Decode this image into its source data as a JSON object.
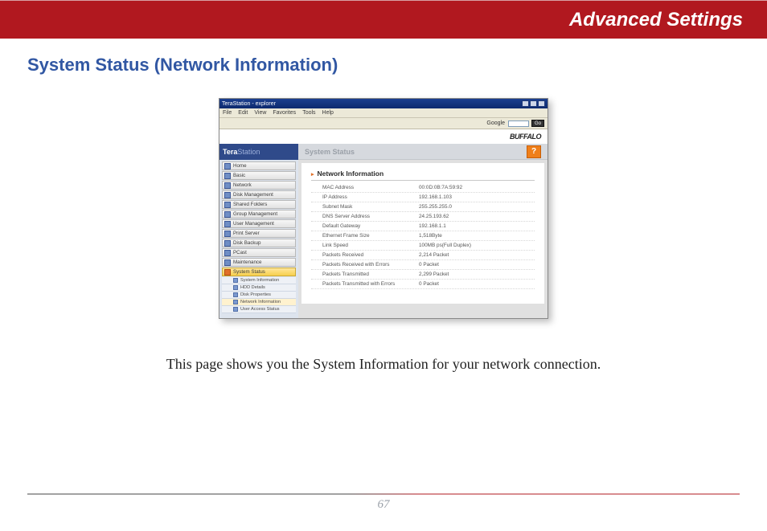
{
  "header": {
    "title": "Advanced Settings"
  },
  "section": {
    "title": "System Status (Network Information)"
  },
  "screenshot": {
    "window_title": "TeraStation - explorer",
    "menu": {
      "file": "File",
      "edit": "Edit",
      "view": "View",
      "favorites": "Favorites",
      "tools": "Tools",
      "help": "Help"
    },
    "search": {
      "label": "Google",
      "go": "Go"
    },
    "brand": "BUFFALO",
    "logo": {
      "tera": "Tera",
      "station": "Station"
    },
    "nav": {
      "items": [
        "Home",
        "Basic",
        "Network",
        "Disk Management",
        "Shared Folders",
        "Group Management",
        "User Management",
        "Print Server",
        "Disk Backup",
        "PCast",
        "Maintenance",
        "System Status"
      ],
      "sub": [
        "System Information",
        "HDD Details",
        "Disk Properties",
        "Network Information",
        "User Access Status"
      ]
    },
    "crumb": "System Status",
    "help_glyph": "?",
    "table": {
      "heading": "Network Information",
      "rows": [
        {
          "label": "MAC Address",
          "value": "00:0D:0B:7A:59:92"
        },
        {
          "label": "IP Address",
          "value": "192.168.1.103"
        },
        {
          "label": "Subnet Mask",
          "value": "255.255.255.0"
        },
        {
          "label": "DNS Server Address",
          "value": "24.25.193.62"
        },
        {
          "label": "Default Gateway",
          "value": "192.168.1.1"
        },
        {
          "label": "Ethernet Frame Size",
          "value": "1,518Byte"
        },
        {
          "label": "Link Speed",
          "value": "100MB ps(Full Duplex)"
        },
        {
          "label": "Packets Received",
          "value": "2,214 Packet"
        },
        {
          "label": "Packets Received with Errors",
          "value": "0 Packet"
        },
        {
          "label": "Packets Transmitted",
          "value": "2,299 Packet"
        },
        {
          "label": "Packets Transmitted with Errors",
          "value": "0 Packet"
        }
      ]
    }
  },
  "body_text": "This page shows you the System Information for your network connection.",
  "page_number": "67"
}
